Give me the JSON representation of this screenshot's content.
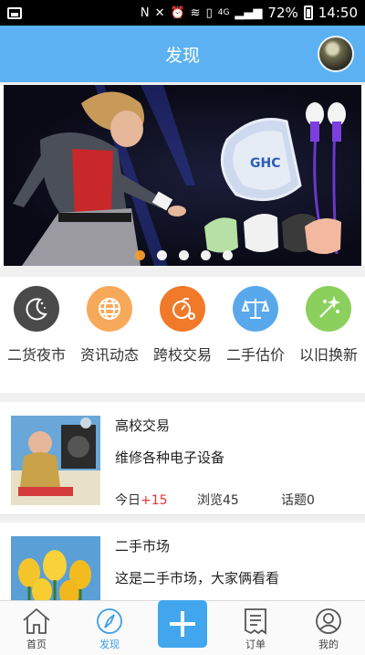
{
  "status_bar": {
    "network": "4G",
    "battery": "72%",
    "time": "14:50"
  },
  "header": {
    "title": "发现"
  },
  "banner": {
    "brand_text": "GHC",
    "slide_count": 5,
    "active_slide": 1
  },
  "categories": [
    {
      "label": "二货夜市",
      "icon": "moon-icon",
      "color": "#4a4a4a"
    },
    {
      "label": "资讯动态",
      "icon": "globe-icon",
      "color": "#f7a95a"
    },
    {
      "label": "跨校交易",
      "icon": "bicycle-icon",
      "color": "#f07a2a"
    },
    {
      "label": "二手估价",
      "icon": "scale-icon",
      "color": "#5aa8ec"
    },
    {
      "label": "以旧换新",
      "icon": "magic-wand-icon",
      "color": "#8bd05c"
    }
  ],
  "list": [
    {
      "name": "高校交易",
      "desc": "维修各种电子设备",
      "today_label": "今日",
      "today_value": "+15",
      "views": "浏览45",
      "topics": "话题0"
    },
    {
      "name": "二手市场",
      "desc": "这是二手市场，大家俩看看"
    }
  ],
  "tabbar": {
    "home": "首页",
    "discover": "发现",
    "orders": "订单",
    "mine": "我的"
  }
}
